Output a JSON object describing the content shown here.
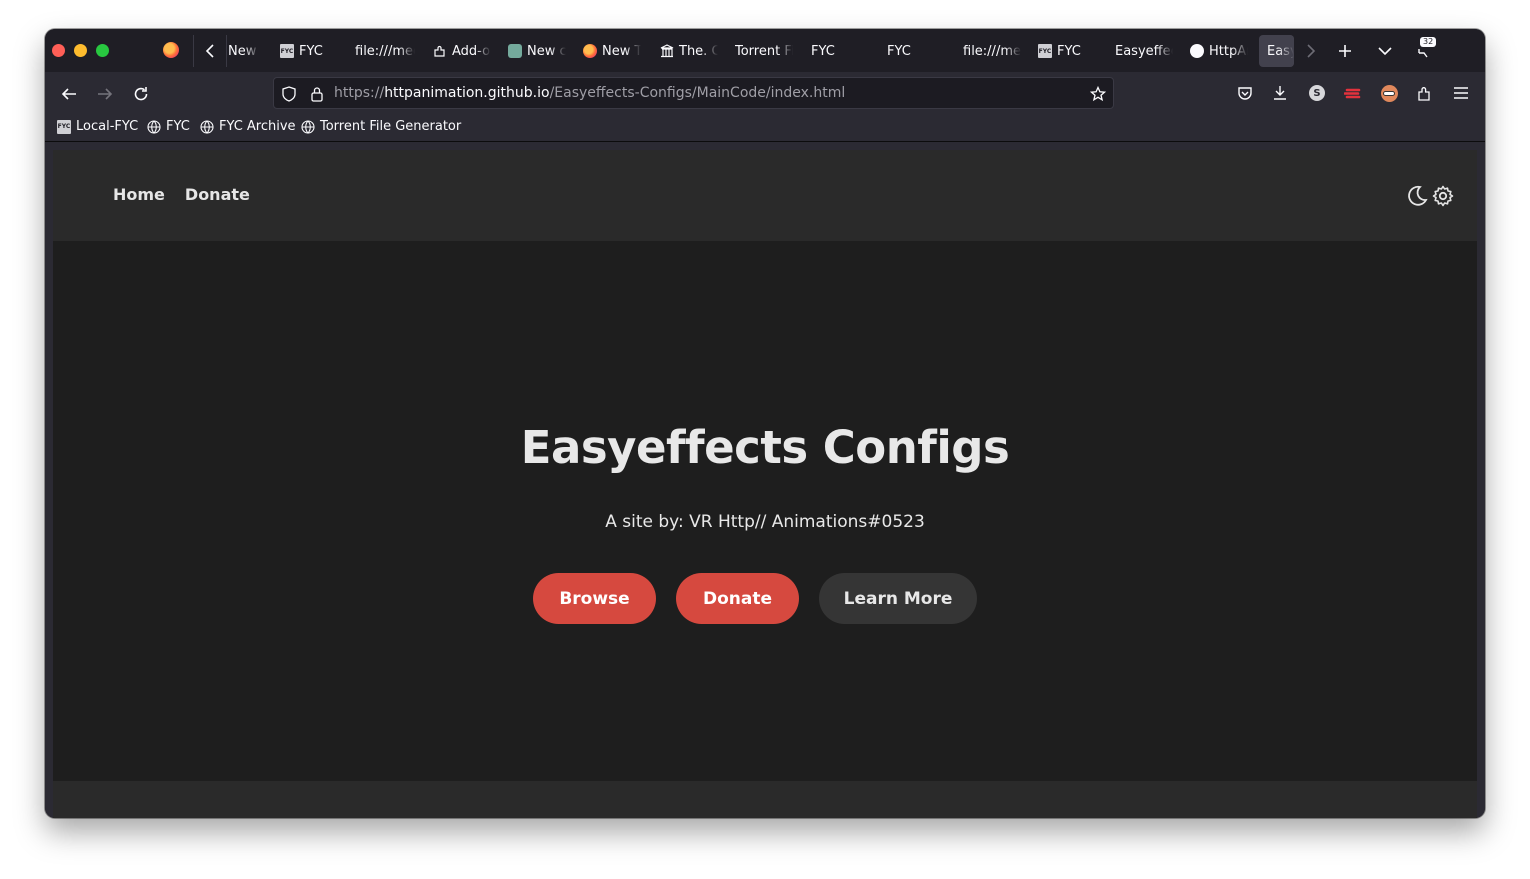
{
  "browser": {
    "tabs": [
      {
        "label": "New Tab",
        "icon": "puzzle-icon"
      },
      {
        "label": "FYC",
        "icon": "fyc-icon"
      },
      {
        "label": "file:///media",
        "icon": ""
      },
      {
        "label": "Add-ons",
        "icon": "puzzle-icon"
      },
      {
        "label": "New chat",
        "icon": "chatgpt-icon"
      },
      {
        "label": "New Tab",
        "icon": "firefox-icon"
      },
      {
        "label": "The. C",
        "icon": "archive-icon"
      },
      {
        "label": "Torrent File",
        "icon": ""
      },
      {
        "label": "FYC",
        "icon": ""
      },
      {
        "label": "FYC",
        "icon": ""
      },
      {
        "label": "file:///media",
        "icon": ""
      },
      {
        "label": "FYC",
        "icon": "fyc-icon"
      },
      {
        "label": "Easyeffects",
        "icon": ""
      },
      {
        "label": "HttpAnimation",
        "icon": "github-icon"
      },
      {
        "label": "Easy",
        "icon": ""
      }
    ],
    "tab_count_badge": "32",
    "url": {
      "scheme": "https://",
      "host": "httpanimation.github.io",
      "path": "/Easyeffects-Configs/MainCode/index.html"
    },
    "bookmarks": [
      {
        "label": "Local-FYC",
        "icon": "fyc-icon"
      },
      {
        "label": "FYC",
        "icon": "globe-icon"
      },
      {
        "label": "FYC Archive",
        "icon": "globe-icon"
      },
      {
        "label": "Torrent File Generator",
        "icon": "globe-icon"
      }
    ]
  },
  "site": {
    "nav": {
      "home": "Home",
      "donate": "Donate"
    },
    "title": "Easyeffects Configs",
    "subtitle": "A site by: VR Http// Animations#0523",
    "buttons": {
      "browse": "Browse",
      "donate": "Donate",
      "learn_more": "Learn More"
    },
    "colors": {
      "accent": "#d6493f",
      "background": "#1e1e1e",
      "header": "#2a2a2a"
    }
  }
}
